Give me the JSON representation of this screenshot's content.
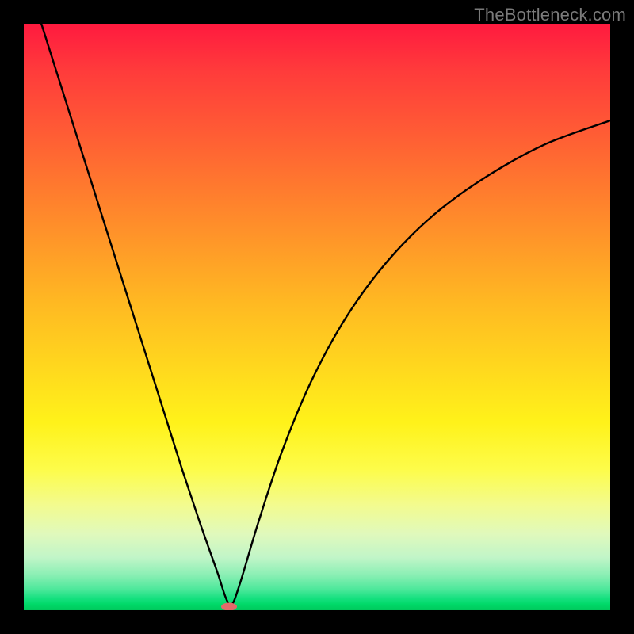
{
  "watermark": {
    "text": "TheBottleneck.com"
  },
  "chart_data": {
    "type": "line",
    "title": "",
    "xlabel": "",
    "ylabel": "",
    "xlim": [
      0,
      1
    ],
    "ylim": [
      0,
      1
    ],
    "background": "rainbow-gradient red→green vertical",
    "series": [
      {
        "name": "v-curve",
        "color": "#000000",
        "x": [
          0.03,
          0.06,
          0.09,
          0.12,
          0.15,
          0.18,
          0.21,
          0.24,
          0.27,
          0.3,
          0.33,
          0.345,
          0.355,
          0.37,
          0.4,
          0.44,
          0.49,
          0.55,
          0.62,
          0.7,
          0.79,
          0.89,
          1.0
        ],
        "y": [
          1.0,
          0.905,
          0.81,
          0.715,
          0.62,
          0.525,
          0.43,
          0.335,
          0.24,
          0.15,
          0.065,
          0.02,
          0.01,
          0.05,
          0.15,
          0.27,
          0.39,
          0.5,
          0.595,
          0.675,
          0.74,
          0.795,
          0.835
        ]
      }
    ],
    "marker": {
      "x": 0.35,
      "y": 0.006,
      "color": "#e36a6a",
      "rx": 10,
      "ry": 5
    }
  }
}
